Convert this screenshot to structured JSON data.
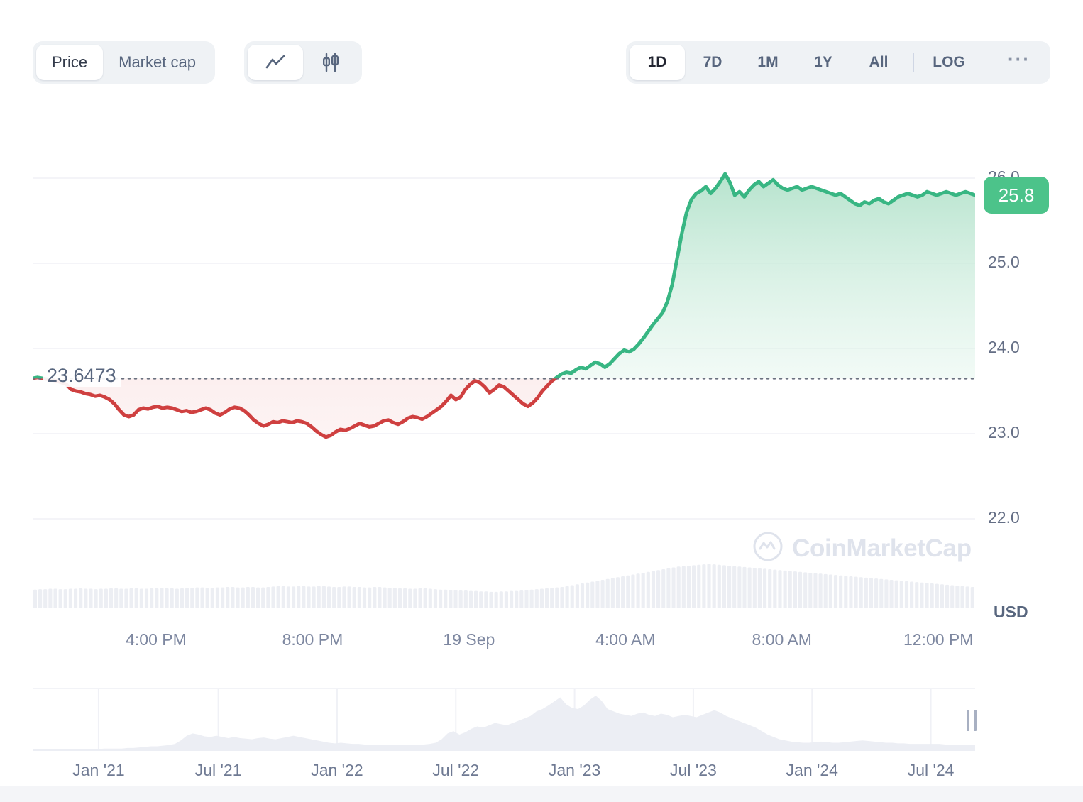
{
  "toolbar": {
    "metric_options": [
      {
        "label": "Price",
        "active": true
      },
      {
        "label": "Market cap",
        "active": false
      }
    ],
    "chart_type_options": [
      {
        "icon": "line-chart-icon",
        "active": true
      },
      {
        "icon": "candlestick-chart-icon",
        "active": false
      }
    ],
    "ranges": [
      {
        "label": "1D",
        "active": true
      },
      {
        "label": "7D",
        "active": false
      },
      {
        "label": "1M",
        "active": false
      },
      {
        "label": "1Y",
        "active": false
      },
      {
        "label": "All",
        "active": false
      }
    ],
    "log_label": "LOG",
    "more_label": "···"
  },
  "chart_data": {
    "type": "area",
    "title": "",
    "xlabel": "",
    "ylabel": "USD",
    "currency": "USD",
    "ylim": [
      21.55,
      26.55
    ],
    "yticks": [
      26.0,
      25.0,
      24.0,
      23.0,
      22.0
    ],
    "ytick_labels": [
      "26.0",
      "25.0",
      "24.0",
      "23.0",
      "22.0"
    ],
    "xtick_labels": [
      "4:00 PM",
      "8:00 PM",
      "19 Sep",
      "4:00 AM",
      "8:00 AM",
      "12:00 PM"
    ],
    "xtick_positions": [
      0.131,
      0.297,
      0.463,
      0.629,
      0.795,
      0.961
    ],
    "grid": true,
    "legend": false,
    "reference_line": {
      "value": 23.6473,
      "label": "23.6473",
      "style": "dotted"
    },
    "last_price_badge": {
      "value": "25.8",
      "color": "#4cc38a"
    },
    "colors": {
      "up_line": "#38b683",
      "up_fill": "#bde5d2",
      "down_line": "#cf4040",
      "down_fill": "#f6d5d5",
      "grid": "#f0f1f5",
      "volume": "#eceef3"
    },
    "series": [
      {
        "name": "Price",
        "values": [
          23.65,
          23.66,
          23.65,
          23.64,
          23.63,
          23.62,
          23.6,
          23.58,
          23.52,
          23.5,
          23.49,
          23.47,
          23.46,
          23.44,
          23.45,
          23.43,
          23.4,
          23.35,
          23.28,
          23.22,
          23.2,
          23.22,
          23.28,
          23.3,
          23.29,
          23.31,
          23.32,
          23.3,
          23.31,
          23.3,
          23.28,
          23.26,
          23.27,
          23.25,
          23.26,
          23.28,
          23.3,
          23.28,
          23.24,
          23.22,
          23.25,
          23.29,
          23.31,
          23.3,
          23.27,
          23.22,
          23.16,
          23.12,
          23.09,
          23.11,
          23.14,
          23.13,
          23.15,
          23.14,
          23.13,
          23.15,
          23.14,
          23.12,
          23.08,
          23.03,
          22.99,
          22.96,
          22.98,
          23.02,
          23.05,
          23.04,
          23.06,
          23.09,
          23.12,
          23.1,
          23.08,
          23.09,
          23.12,
          23.15,
          23.16,
          23.13,
          23.11,
          23.14,
          23.18,
          23.2,
          23.19,
          23.17,
          23.2,
          23.24,
          23.28,
          23.32,
          23.38,
          23.45,
          23.4,
          23.43,
          23.52,
          23.58,
          23.62,
          23.6,
          23.55,
          23.48,
          23.52,
          23.57,
          23.55,
          23.5,
          23.45,
          23.4,
          23.35,
          23.32,
          23.36,
          23.42,
          23.5,
          23.56,
          23.62,
          23.66,
          23.7,
          23.72,
          23.71,
          23.75,
          23.78,
          23.76,
          23.8,
          23.84,
          23.82,
          23.78,
          23.82,
          23.88,
          23.94,
          23.98,
          23.96,
          23.99,
          24.05,
          24.12,
          24.2,
          24.28,
          24.35,
          24.42,
          24.55,
          24.75,
          25.05,
          25.35,
          25.6,
          25.75,
          25.82,
          25.85,
          25.9,
          25.82,
          25.88,
          25.96,
          26.05,
          25.95,
          25.8,
          25.84,
          25.78,
          25.86,
          25.92,
          25.96,
          25.9,
          25.94,
          25.98,
          25.92,
          25.88,
          25.86,
          25.88,
          25.9,
          25.86,
          25.88,
          25.9,
          25.88,
          25.86,
          25.84,
          25.82,
          25.8,
          25.82,
          25.78,
          25.74,
          25.7,
          25.68,
          25.72,
          25.7,
          25.74,
          25.76,
          25.72,
          25.7,
          25.74,
          25.78,
          25.8,
          25.82,
          25.8,
          25.78,
          25.8,
          25.84,
          25.82,
          25.8,
          25.82,
          25.84,
          25.82,
          25.8,
          25.82,
          25.84,
          25.82,
          25.8
        ]
      }
    ],
    "volume_series": {
      "name": "Volume",
      "normalized": [
        0.42,
        0.43,
        0.43,
        0.44,
        0.44,
        0.43,
        0.43,
        0.44,
        0.44,
        0.45,
        0.44,
        0.44,
        0.43,
        0.44,
        0.44,
        0.45,
        0.45,
        0.44,
        0.44,
        0.45,
        0.45,
        0.44,
        0.44,
        0.45,
        0.45,
        0.46,
        0.45,
        0.45,
        0.44,
        0.45,
        0.46,
        0.46,
        0.47,
        0.47,
        0.46,
        0.46,
        0.47,
        0.47,
        0.48,
        0.48,
        0.47,
        0.47,
        0.48,
        0.48,
        0.47,
        0.47,
        0.48,
        0.49,
        0.5,
        0.5,
        0.49,
        0.49,
        0.5,
        0.5,
        0.49,
        0.49,
        0.5,
        0.5,
        0.49,
        0.48,
        0.48,
        0.49,
        0.49,
        0.48,
        0.48,
        0.47,
        0.47,
        0.48,
        0.48,
        0.47,
        0.46,
        0.46,
        0.45,
        0.45,
        0.44,
        0.44,
        0.45,
        0.45,
        0.44,
        0.43,
        0.42,
        0.42,
        0.41,
        0.41,
        0.4,
        0.4,
        0.39,
        0.39,
        0.38,
        0.38,
        0.37,
        0.37,
        0.38,
        0.38,
        0.39,
        0.39,
        0.4,
        0.41,
        0.42,
        0.43,
        0.44,
        0.45,
        0.46,
        0.47,
        0.48,
        0.5,
        0.52,
        0.54,
        0.56,
        0.58,
        0.6,
        0.62,
        0.64,
        0.66,
        0.68,
        0.7,
        0.72,
        0.74,
        0.76,
        0.78,
        0.8,
        0.82,
        0.84,
        0.86,
        0.88,
        0.9,
        0.92,
        0.94,
        0.95,
        0.96,
        0.97,
        0.98,
        0.99,
        1.0,
        0.99,
        0.98,
        0.97,
        0.96,
        0.95,
        0.94,
        0.93,
        0.92,
        0.91,
        0.9,
        0.89,
        0.88,
        0.87,
        0.86,
        0.85,
        0.84,
        0.83,
        0.82,
        0.81,
        0.8,
        0.79,
        0.78,
        0.77,
        0.76,
        0.75,
        0.74,
        0.73,
        0.72,
        0.71,
        0.7,
        0.69,
        0.68,
        0.67,
        0.66,
        0.65,
        0.64,
        0.63,
        0.62,
        0.61,
        0.6,
        0.59,
        0.58,
        0.57,
        0.56,
        0.55,
        0.54,
        0.53,
        0.52,
        0.51,
        0.5,
        0.49,
        0.48
      ]
    }
  },
  "navigator": {
    "labels": [
      "Jan '21",
      "Jul '21",
      "Jan '22",
      "Jul '22",
      "Jan '23",
      "Jul '23",
      "Jan '24",
      "Jul '24"
    ],
    "label_positions": [
      0.07,
      0.197,
      0.323,
      0.449,
      0.575,
      0.701,
      0.827,
      0.953
    ],
    "area_normalized": [
      0.03,
      0.03,
      0.03,
      0.03,
      0.03,
      0.03,
      0.03,
      0.03,
      0.03,
      0.03,
      0.03,
      0.03,
      0.04,
      0.04,
      0.04,
      0.04,
      0.05,
      0.05,
      0.06,
      0.07,
      0.08,
      0.08,
      0.09,
      0.1,
      0.12,
      0.18,
      0.26,
      0.3,
      0.28,
      0.25,
      0.24,
      0.26,
      0.24,
      0.22,
      0.24,
      0.22,
      0.21,
      0.2,
      0.22,
      0.23,
      0.21,
      0.2,
      0.22,
      0.24,
      0.26,
      0.24,
      0.22,
      0.2,
      0.18,
      0.16,
      0.14,
      0.13,
      0.14,
      0.13,
      0.12,
      0.12,
      0.11,
      0.11,
      0.1,
      0.1,
      0.1,
      0.1,
      0.1,
      0.1,
      0.1,
      0.1,
      0.11,
      0.12,
      0.14,
      0.2,
      0.3,
      0.34,
      0.28,
      0.32,
      0.38,
      0.42,
      0.4,
      0.44,
      0.48,
      0.46,
      0.44,
      0.48,
      0.52,
      0.56,
      0.6,
      0.68,
      0.72,
      0.78,
      0.85,
      0.92,
      0.8,
      0.74,
      0.72,
      0.78,
      0.88,
      0.95,
      0.86,
      0.72,
      0.68,
      0.64,
      0.62,
      0.6,
      0.64,
      0.66,
      0.62,
      0.6,
      0.64,
      0.62,
      0.58,
      0.6,
      0.62,
      0.6,
      0.58,
      0.62,
      0.66,
      0.7,
      0.66,
      0.6,
      0.56,
      0.52,
      0.48,
      0.44,
      0.4,
      0.34,
      0.28,
      0.24,
      0.2,
      0.18,
      0.16,
      0.15,
      0.14,
      0.14,
      0.15,
      0.16,
      0.15,
      0.14,
      0.14,
      0.15,
      0.16,
      0.17,
      0.18,
      0.17,
      0.16,
      0.15,
      0.14,
      0.14,
      0.13,
      0.13,
      0.12,
      0.12,
      0.12,
      0.12,
      0.12,
      0.12,
      0.11,
      0.11,
      0.11,
      0.11,
      0.11,
      0.1
    ],
    "gridline_positions": [
      0.07,
      0.197,
      0.323,
      0.449,
      0.575,
      0.701,
      0.827,
      0.953
    ],
    "handle": "navigator-right-handle"
  },
  "watermark": {
    "text": "CoinMarketCap",
    "logo": "coinmarketcap-logo-icon"
  }
}
